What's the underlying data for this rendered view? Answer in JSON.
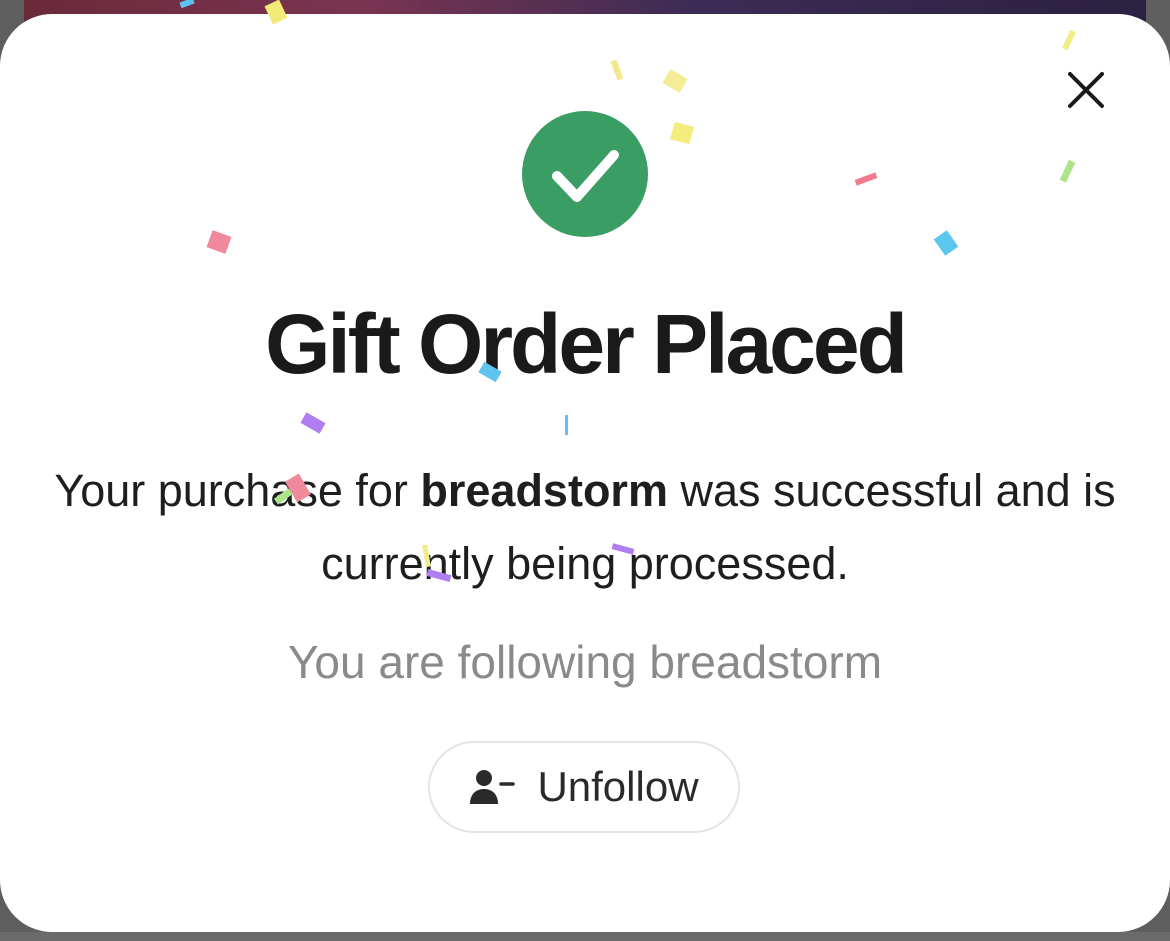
{
  "dialog": {
    "title": "Gift Order Placed",
    "message_prefix": "Your purchase for ",
    "recipient": "breadstorm",
    "message_suffix": " was successful and is currently being processed.",
    "follow_status": "You are following breadstorm",
    "unfollow_label": "Unfollow",
    "close_icon": "close-icon",
    "success_icon": "checkmark-circle-icon",
    "unfollow_icon": "user-minus-icon"
  },
  "colors": {
    "success": "#3a9d64",
    "title": "#1a1a1a",
    "secondary_text": "#8a8a8a",
    "button_border": "#e4e4e4"
  }
}
